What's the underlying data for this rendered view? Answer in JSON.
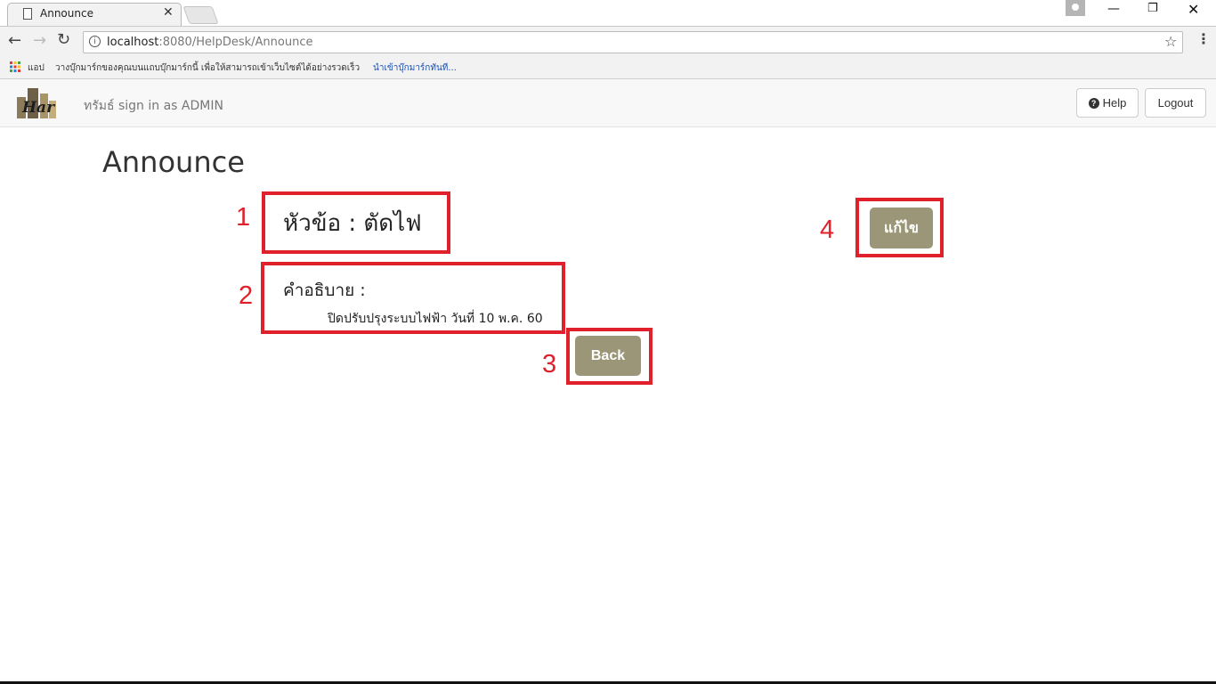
{
  "browser": {
    "tab_title": "Announce",
    "url_host": "localhost",
    "url_rest": ":8080/HelpDesk/Announce",
    "bookmarks_apps_label": "แอป",
    "bookmarks_hint": "วางบุ๊กมาร์กของคุณบนแถบบุ๊กมาร์กนี้ เพื่อให้สามารถเข้าเว็บไซต์ได้อย่างรวดเร็ว",
    "bookmarks_link": "นำเข้าบุ๊กมาร์กทันที..."
  },
  "navbar": {
    "logo_text": "Har",
    "signin_text": "ทรัมธ์ sign in as ADMIN",
    "help_label": "Help",
    "logout_label": "Logout"
  },
  "page": {
    "title": "Announce",
    "topic": "หัวข้อ : ตัดไฟ",
    "description_label": "คำอธิบาย :",
    "description_text": "ปิดปรับปรุงระบบไฟฟ้า วันที่ 10 พ.ค. 60",
    "back_label": "Back",
    "edit_label": "แก้ไข"
  },
  "annotations": {
    "marker_1": "1",
    "marker_2": "2",
    "marker_3": "3",
    "marker_4": "4",
    "box_color": "#e0202b"
  },
  "colors": {
    "button_olive": "#9a9677"
  }
}
